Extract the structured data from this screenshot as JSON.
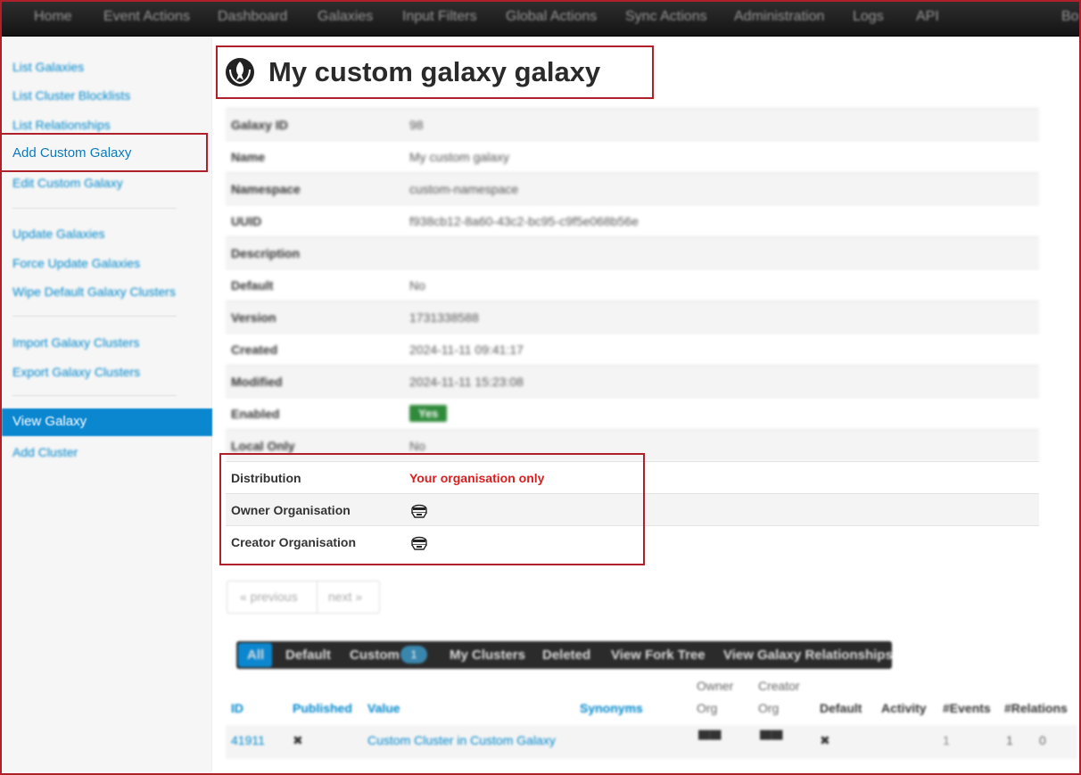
{
  "nav": {
    "items": [
      "Home",
      "Event Actions",
      "Dashboard",
      "Galaxies",
      "Input Filters",
      "Global Actions",
      "Sync Actions",
      "Administration",
      "Logs",
      "API"
    ],
    "right_label": "Bo"
  },
  "sidebar": {
    "links": {
      "list_galaxies": "List Galaxies",
      "list_cluster_blocklists": "List Cluster Blocklists",
      "list_relationships": "List Relationships",
      "add_custom_galaxy": "Add Custom Galaxy",
      "edit_custom_galaxy": "Edit Custom Galaxy",
      "update_galaxies": "Update Galaxies",
      "force_update_galaxies": "Force Update Galaxies",
      "wipe_default_clusters": "Wipe Default Galaxy Clusters",
      "import_clusters": "Import Galaxy Clusters",
      "export_clusters": "Export Galaxy Clusters",
      "view_galaxy": "View Galaxy",
      "add_cluster": "Add Cluster"
    }
  },
  "page": {
    "title": "My custom galaxy galaxy",
    "icon": "rebel-alliance-icon"
  },
  "details": [
    {
      "key": "Galaxy ID",
      "value": "98"
    },
    {
      "key": "Name",
      "value": "My custom galaxy"
    },
    {
      "key": "Namespace",
      "value": "custom-namespace"
    },
    {
      "key": "UUID",
      "value": "f938cb12-8a60-43c2-bc95-c9f5e068b56e"
    },
    {
      "key": "Description",
      "value": ""
    },
    {
      "key": "Default",
      "value": "No"
    },
    {
      "key": "Version",
      "value": "1731338588"
    },
    {
      "key": "Created",
      "value": "2024-11-11 09:41:17"
    },
    {
      "key": "Modified",
      "value": "2024-11-11 15:23:08"
    },
    {
      "key": "Enabled",
      "value": "Yes"
    },
    {
      "key": "Local Only",
      "value": "No"
    },
    {
      "key": "Distribution",
      "value": "Your organisation only"
    },
    {
      "key": "Owner Organisation",
      "value": ""
    },
    {
      "key": "Creator Organisation",
      "value": ""
    }
  ],
  "pager": {
    "previous": "« previous",
    "next": "next »"
  },
  "filters": {
    "all": "All",
    "default": "Default",
    "custom": "Custom",
    "custom_count": "1",
    "my_clusters": "My Clusters",
    "deleted": "Deleted",
    "fork_tree": "View Fork Tree",
    "relationships": "View Galaxy Relationships"
  },
  "clusters": {
    "headers": {
      "id": "ID",
      "published": "Published",
      "value": "Value",
      "synonyms": "Synonyms",
      "owner_top": "Owner",
      "owner_bottom": "Org",
      "creator_top": "Creator",
      "creator_bottom": "Org",
      "default": "Default",
      "activity": "Activity",
      "events": "#Events",
      "relations": "#Relations"
    },
    "rows": [
      {
        "id": "41911",
        "published": "✖",
        "value": "Custom Cluster in Custom Galaxy",
        "default": "✖",
        "events": "1",
        "rel_a": "1",
        "rel_b": "0"
      }
    ]
  },
  "colors": {
    "highlight": "#b0202a",
    "link": "#0088cc",
    "distribution": "#d91f1f",
    "enabled": "#2f8a3a"
  }
}
